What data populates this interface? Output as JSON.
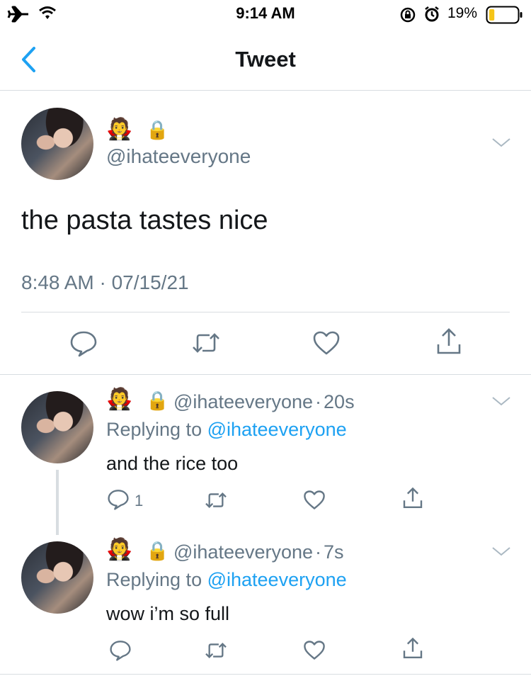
{
  "status_bar": {
    "time": "9:14 AM",
    "battery_percent": "19%",
    "battery_level": 0.19
  },
  "nav": {
    "title": "Tweet"
  },
  "main_tweet": {
    "name_emoji": "🧛",
    "lock_emoji": "🔒",
    "handle": "@ihateeveryone",
    "text": "the pasta tastes nice",
    "timestamp": "8:48 AM · 07/15/21"
  },
  "replies": [
    {
      "name_emoji": "🧛",
      "lock_emoji": "🔒",
      "handle": "@ihateeveryone",
      "sep": "·",
      "age": "20s",
      "replying_prefix": "Replying to ",
      "replying_handle": "@ihateeveryone",
      "text": "and the rice too",
      "reply_count": "1"
    },
    {
      "name_emoji": "🧛",
      "lock_emoji": "🔒",
      "handle": "@ihateeveryone",
      "sep": "·",
      "age": "7s",
      "replying_prefix": "Replying to ",
      "replying_handle": "@ihateeveryone",
      "text": "wow i’m so full",
      "reply_count": ""
    }
  ],
  "colors": {
    "accent": "#1da1f2",
    "secondary_text": "#657786",
    "divider": "#d8dde1",
    "battery_low": "#f5c518"
  }
}
